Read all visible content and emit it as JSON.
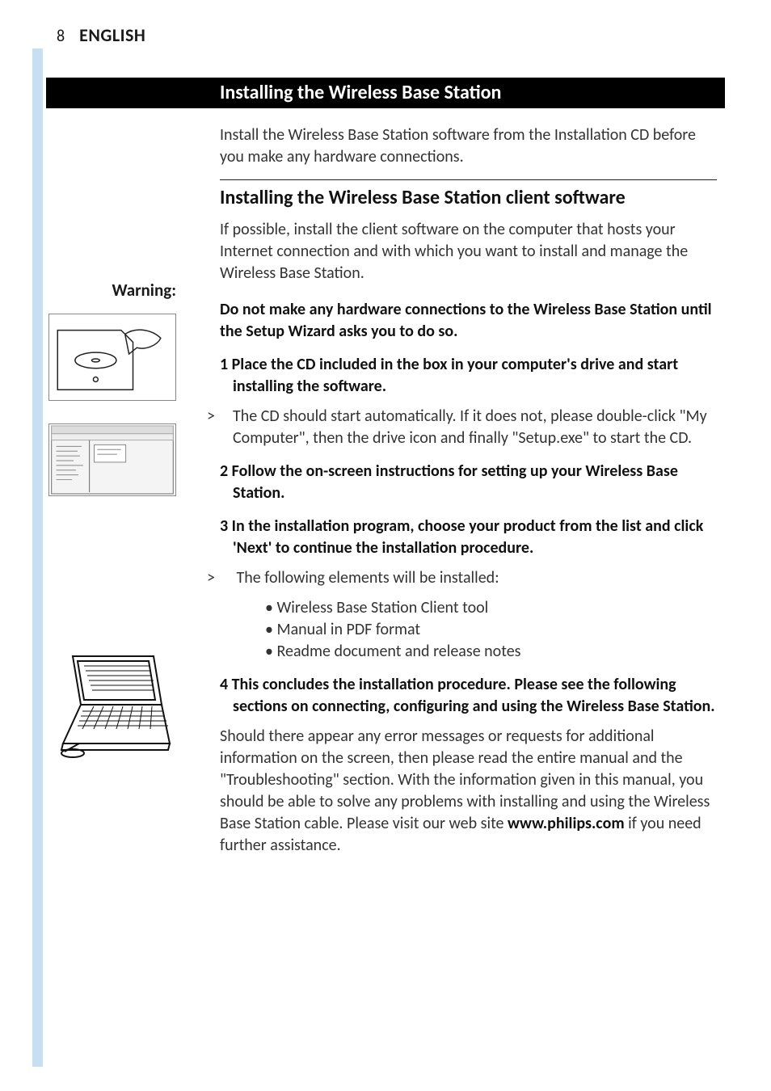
{
  "header": {
    "page_number": "8",
    "language": "ENGLISH"
  },
  "title_bar": "Installing the Wireless Base Station",
  "intro": "Install the Wireless Base Station software from the Installation CD before you make any hardware connections.",
  "subhead": "Installing the Wireless Base Station client software",
  "subhead_text": "If possible, install the client software on the computer that hosts your Internet connection and with which you want to install and manage the Wireless Base Station.",
  "warning_label": "Warning:",
  "warning_text": "Do not make any hardware connections to the Wireless Base Station until the Setup Wizard asks you to do so.",
  "step1_head": "1 Place the CD included in the box in your computer's drive and start installing the software.",
  "step1_note": "The CD should start automatically. If it does not, please double-click \"My Computer\", then the drive icon and finally \"Setup.exe\" to start the CD.",
  "step2_head": "2 Follow the on-screen instructions for setting up your Wireless Base Station.",
  "step3_head": "3 In the installation program, choose your product from the list and click 'Next' to continue the installation procedure.",
  "step3_note": "The following elements will be installed:",
  "step3_bullets": [
    "Wireless Base Station Client tool",
    "Manual in PDF format",
    "Readme document and release notes"
  ],
  "step4_head": "4 This concludes the installation procedure. Please see the following sections on connecting, configuring and using the Wireless Base Station.",
  "final_text_pre": "Should there appear any error messages or requests for additional information on the screen, then please read the entire manual and the \"Troubleshooting\" section. With the information given in this manual, you should be able to solve any problems with installing and using the Wireless Base Station cable. Please visit our web site ",
  "final_text_link": "www.philips.com",
  "final_text_post": " if you need further assistance."
}
